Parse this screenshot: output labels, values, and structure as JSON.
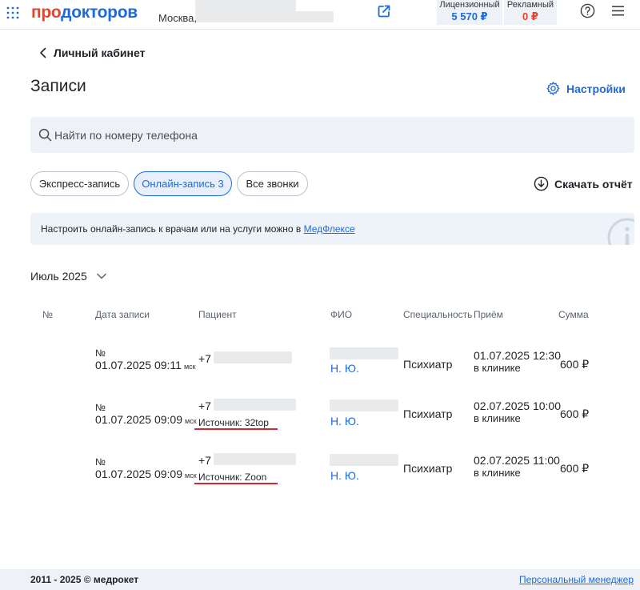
{
  "header": {
    "logo_part1": "про",
    "logo_part2": "докторов",
    "city": "Москва,",
    "balances": [
      {
        "label": "Лицензионный",
        "value": "5 570 ₽"
      },
      {
        "label": "Рекламный",
        "value": "0 ₽"
      }
    ],
    "icons": [
      "grid-icon",
      "external-link-icon",
      "help-icon",
      "menu-icon"
    ]
  },
  "back": {
    "label": "Личный кабинет"
  },
  "page": {
    "title": "Записи",
    "settings_label": "Настройки"
  },
  "search": {
    "placeholder": "Найти по номеру телефона",
    "value": ""
  },
  "filters": [
    {
      "label": "Экспресс-запись",
      "active": false
    },
    {
      "label": "Онлайн-запись 3",
      "active": true
    },
    {
      "label": "Все звонки",
      "active": false
    }
  ],
  "download": {
    "label": "Скачать отчёт"
  },
  "info": {
    "text": "Настроить онлайн-запись к врачам или на услуги можно в ",
    "link": "МедФлексе"
  },
  "month": {
    "value": "Июль 2025"
  },
  "table": {
    "headers": [
      "№",
      "Дата записи",
      "Пациент",
      "ФИО",
      "Специальность",
      "Приём",
      "Сумма"
    ],
    "rows": [
      {
        "num_label": "№",
        "date": "01.07.2025 09:11",
        "tz": "мск",
        "phone": "+7",
        "source": "",
        "fio": "Н. Ю.",
        "specialty": "Психиатр",
        "visit_date": "01.07.2025 12:30",
        "visit_place": "в клинике",
        "sum": "600 ₽"
      },
      {
        "num_label": "№",
        "date": "01.07.2025 09:09",
        "tz": "мск",
        "phone": "+7",
        "source": "Источник: 32top",
        "fio": "Н. Ю.",
        "specialty": "Психиатр",
        "visit_date": "02.07.2025 10:00",
        "visit_place": "в клинике",
        "sum": "600 ₽"
      },
      {
        "num_label": "№",
        "date": "01.07.2025 09:09",
        "tz": "мск",
        "phone": "+7",
        "source": "Источник: Zoon",
        "fio": "Н. Ю.",
        "specialty": "Психиатр",
        "visit_date": "02.07.2025 11:00",
        "visit_place": "в клинике",
        "sum": "600 ₽"
      }
    ]
  },
  "footer": {
    "copyright": "2011 - 2025 © медрокет",
    "manager_link": "Персональный менеджер"
  },
  "colors": {
    "accent": "#1e6ad8",
    "brand_red": "#e8412c",
    "highlight_underline": "#d8262c",
    "panel_bg": "#eef2f7"
  }
}
